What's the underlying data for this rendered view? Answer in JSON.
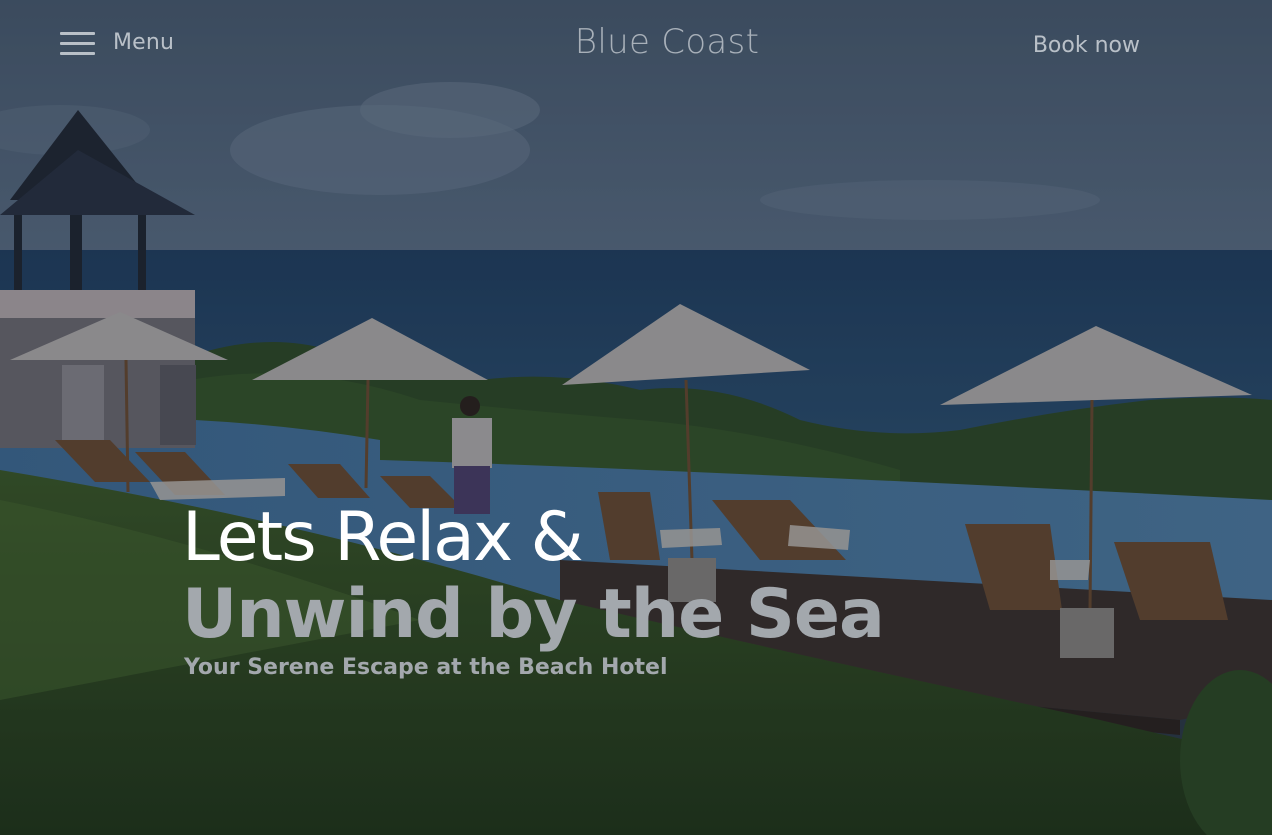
{
  "header": {
    "menu_label": "Menu",
    "brand": "Blue Coast",
    "book_label": "Book now"
  },
  "hero": {
    "headline_line1": "Lets Relax &",
    "headline_line2": "Unwind by the Sea",
    "subtitle": "Your Serene Escape at the Beach Hotel"
  },
  "icons": {
    "menu": "hamburger-icon"
  }
}
